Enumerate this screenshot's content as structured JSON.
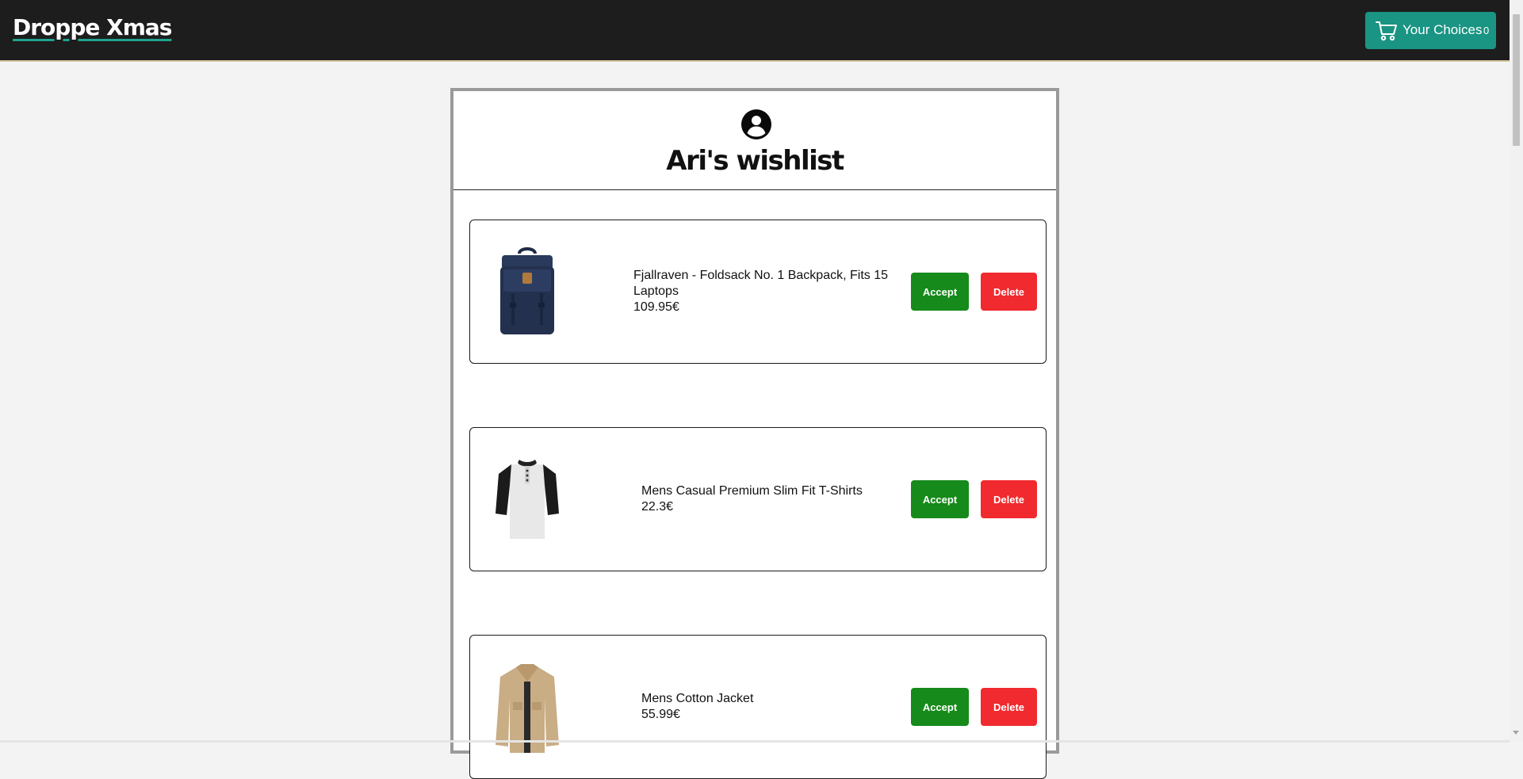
{
  "navbar": {
    "brand": "Droppe Xmas",
    "cart_label": "Your Choices",
    "cart_count": "0",
    "cart_icon": "shopping-cart-icon"
  },
  "wishlist": {
    "owner_icon": "user-circle-icon",
    "title": "Ari's wishlist",
    "items": [
      {
        "name": "Fjallraven - Foldsack No. 1 Backpack, Fits 15 Laptops",
        "price": "109.95€",
        "accept_label": "Accept",
        "delete_label": "Delete"
      },
      {
        "name": "Mens Casual Premium Slim Fit T-Shirts",
        "price": "22.3€",
        "accept_label": "Accept",
        "delete_label": "Delete"
      },
      {
        "name": "Mens Cotton Jacket",
        "price": "55.99€",
        "accept_label": "Accept",
        "delete_label": "Delete"
      }
    ]
  },
  "colors": {
    "navbar_bg": "#1d1d1d",
    "cart_button": "#1a9483",
    "accept": "#168a1a",
    "delete": "#f02a2e"
  }
}
